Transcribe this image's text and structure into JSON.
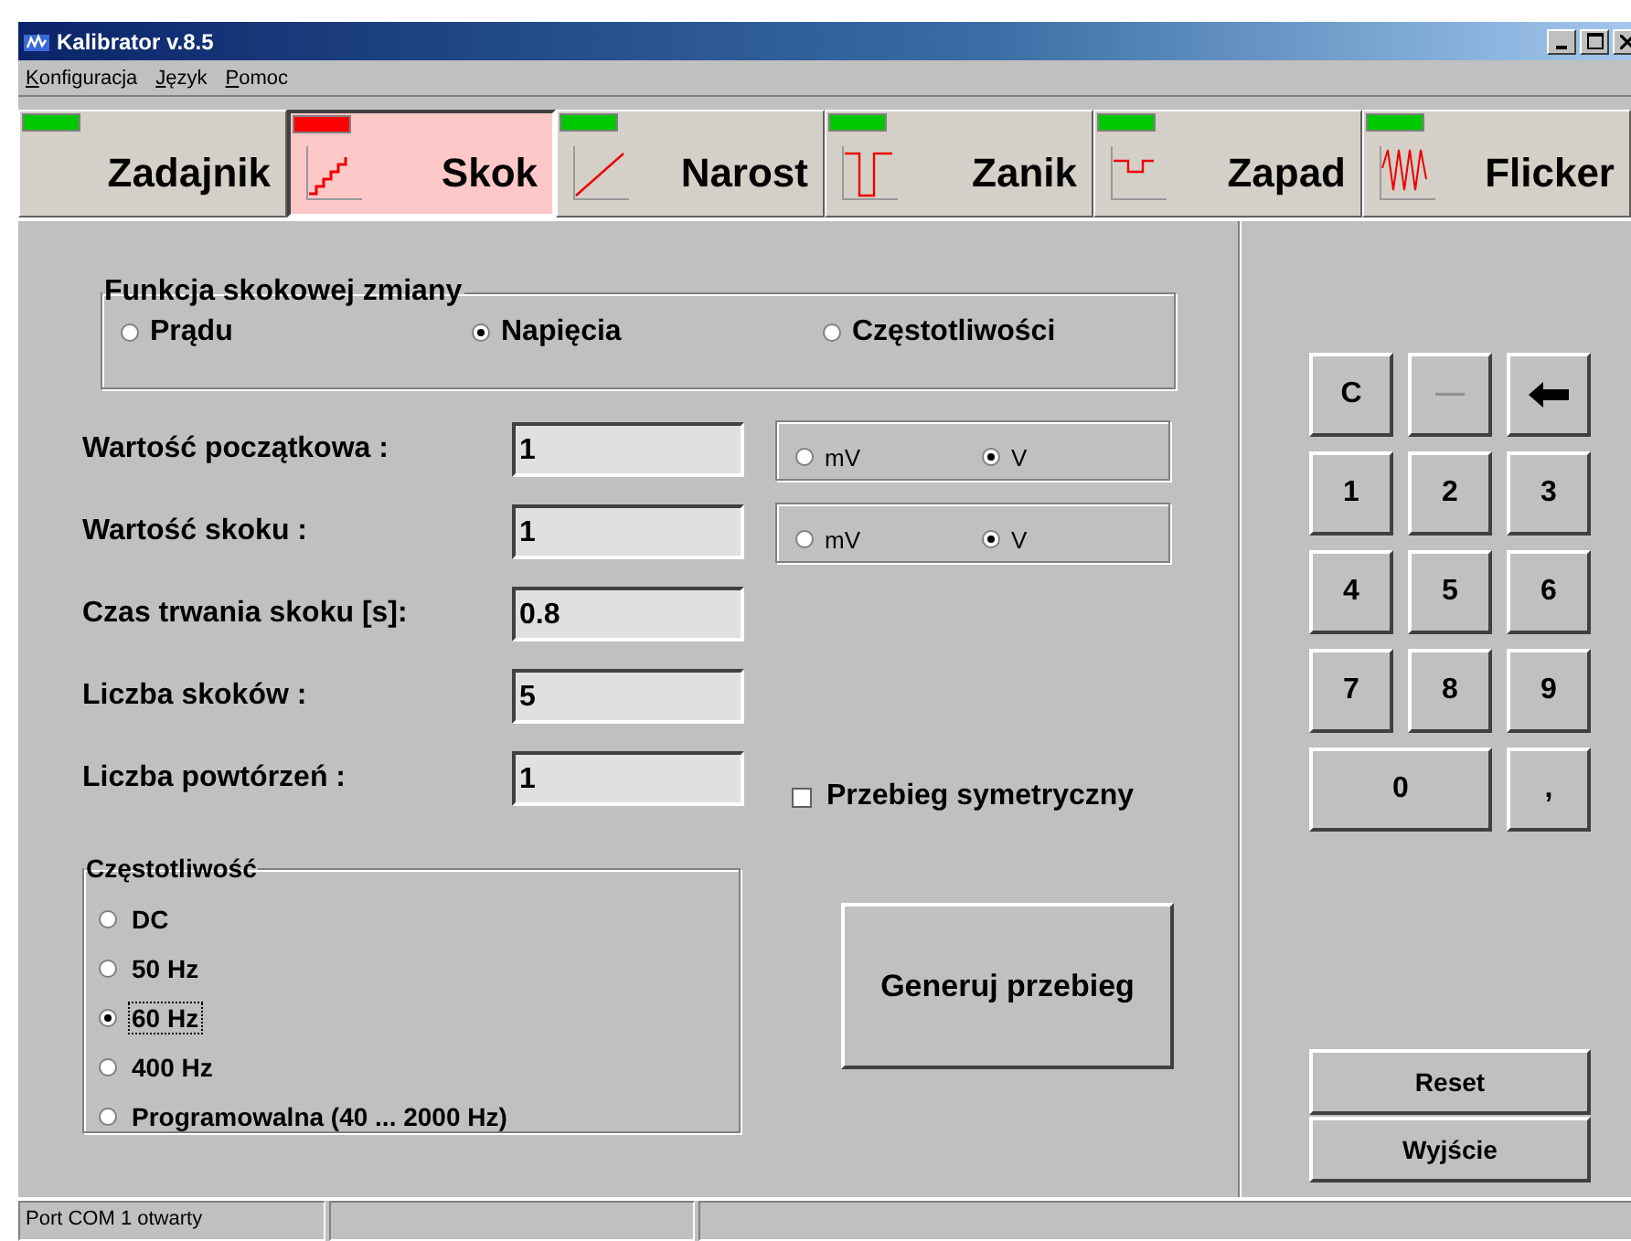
{
  "window": {
    "title": "Kalibrator v.8.5"
  },
  "menu": [
    {
      "label": "Konfiguracja"
    },
    {
      "label": "Język"
    },
    {
      "label": "Pomoc"
    }
  ],
  "tabs": [
    {
      "label": "Zadajnik",
      "kind": "none",
      "color": "#00c800",
      "selected": false
    },
    {
      "label": "Skok",
      "kind": "stairs",
      "color": "#ff0000",
      "selected": true
    },
    {
      "label": "Narost",
      "kind": "ramp",
      "color": "#00c800",
      "selected": false
    },
    {
      "label": "Zanik",
      "kind": "pulse",
      "color": "#00c800",
      "selected": false
    },
    {
      "label": "Zapad",
      "kind": "dip",
      "color": "#00c800",
      "selected": false
    },
    {
      "label": "Flicker",
      "kind": "noise",
      "color": "#00c800",
      "selected": false
    }
  ],
  "function_group": {
    "title": "Funkcja skokowej zmiany",
    "options": [
      {
        "label": "Prądu",
        "selected": false
      },
      {
        "label": "Napięcia",
        "selected": true
      },
      {
        "label": "Częstotliwości",
        "selected": false
      }
    ]
  },
  "fields": [
    {
      "label": "Wartość początkowa :",
      "value": "1",
      "units": [
        {
          "label": "mV",
          "selected": false
        },
        {
          "label": "V",
          "selected": true
        }
      ]
    },
    {
      "label": "Wartość skoku :",
      "value": "1",
      "units": [
        {
          "label": "mV",
          "selected": false
        },
        {
          "label": "V",
          "selected": true
        }
      ]
    },
    {
      "label": "Czas trwania skoku [s]:",
      "value": "0.8"
    },
    {
      "label": "Liczba skoków :",
      "value": "5"
    },
    {
      "label": "Liczba powtórzeń :",
      "value": "1"
    }
  ],
  "symmetric": {
    "label": "Przebieg symetryczny",
    "checked": false
  },
  "frequency_group": {
    "title": "Częstotliwość",
    "options": [
      {
        "label": "DC",
        "selected": false,
        "focused": false
      },
      {
        "label": "50 Hz",
        "selected": false,
        "focused": false
      },
      {
        "label": "60 Hz",
        "selected": true,
        "focused": true
      },
      {
        "label": "400 Hz",
        "selected": false,
        "focused": false
      },
      {
        "label": "Programowalna (40 ... 2000 Hz)",
        "selected": false,
        "focused": false
      }
    ]
  },
  "generate_button": "Generuj przebieg",
  "keypad": [
    {
      "kind": "text",
      "label": "C",
      "disabled": false
    },
    {
      "kind": "text",
      "label": "—",
      "disabled": true
    },
    {
      "kind": "backspace",
      "disabled": false
    },
    {
      "kind": "text",
      "label": "1",
      "disabled": false
    },
    {
      "kind": "text",
      "label": "2",
      "disabled": false
    },
    {
      "kind": "text",
      "label": "3",
      "disabled": false
    },
    {
      "kind": "text",
      "label": "4",
      "disabled": false
    },
    {
      "kind": "text",
      "label": "5",
      "disabled": false
    },
    {
      "kind": "text",
      "label": "6",
      "disabled": false
    },
    {
      "kind": "text",
      "label": "7",
      "disabled": false
    },
    {
      "kind": "text",
      "label": "8",
      "disabled": false
    },
    {
      "kind": "text",
      "label": "9",
      "disabled": false
    },
    {
      "kind": "wide",
      "label": "0",
      "disabled": false
    },
    {
      "kind": "text",
      "label": ",",
      "disabled": false
    }
  ],
  "actions": [
    "Reset",
    "Wyjście"
  ],
  "status_bar": [
    "Port COM 1 otwarty"
  ]
}
